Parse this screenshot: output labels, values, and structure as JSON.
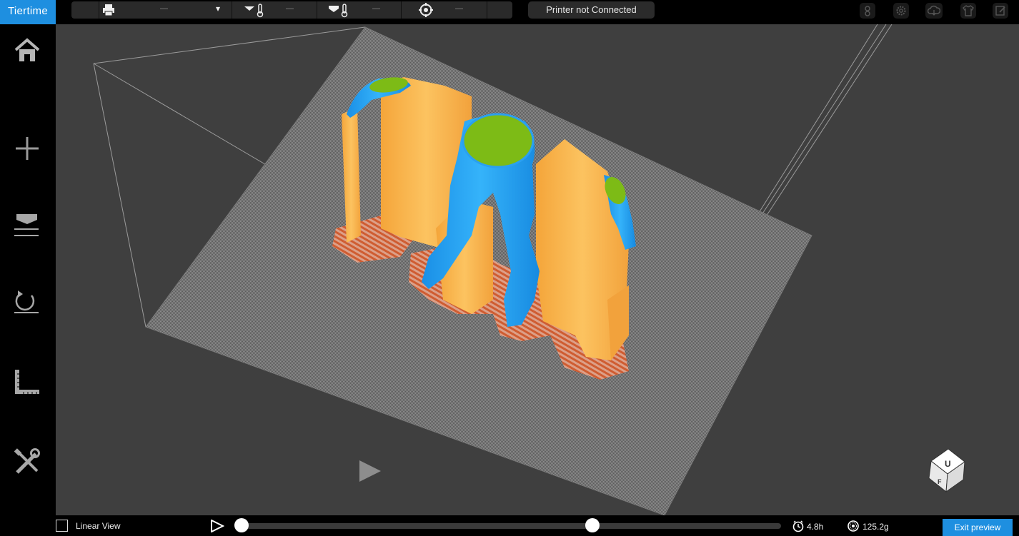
{
  "app": {
    "brand": "Tiertime"
  },
  "toolbar": {
    "printer_select": {
      "value": "—",
      "icon": "printer-icon",
      "caret": "▾"
    },
    "nozzle_temp": {
      "value": "—",
      "icon": "nozzle-thermometer-icon"
    },
    "bed_temp": {
      "value": "—",
      "icon": "bed-thermometer-icon"
    },
    "calibration": {
      "value": "—",
      "icon": "target-icon"
    },
    "printer_status": "Printer not Connected",
    "right_icons": [
      "account-icon",
      "settings-gear-icon",
      "cloud-icon",
      "tshirt-icon",
      "edit-icon"
    ]
  },
  "sidebar": {
    "items": [
      {
        "name": "home",
        "icon": "home-icon"
      },
      {
        "name": "add",
        "icon": "plus-icon"
      },
      {
        "name": "print",
        "icon": "print-tray-icon"
      },
      {
        "name": "rotate",
        "icon": "rotate-icon"
      },
      {
        "name": "measure",
        "icon": "ruler-icon"
      },
      {
        "name": "tools",
        "icon": "tools-icon"
      }
    ]
  },
  "viewport": {
    "view_cube": {
      "face_top": "U",
      "face_front": "F"
    },
    "colors": {
      "model": "#1e9df0",
      "support": "#f5a731",
      "raft": "#e06a3a",
      "top_face": "#7dbb16",
      "background": "#3f3f3f"
    }
  },
  "bottom": {
    "linear_view_label": "Linear View",
    "linear_view_checked": false,
    "layer_range": {
      "start": 0,
      "end": 0.65
    },
    "time": "4.8h",
    "weight": "125.2g",
    "exit_label": "Exit preview"
  }
}
